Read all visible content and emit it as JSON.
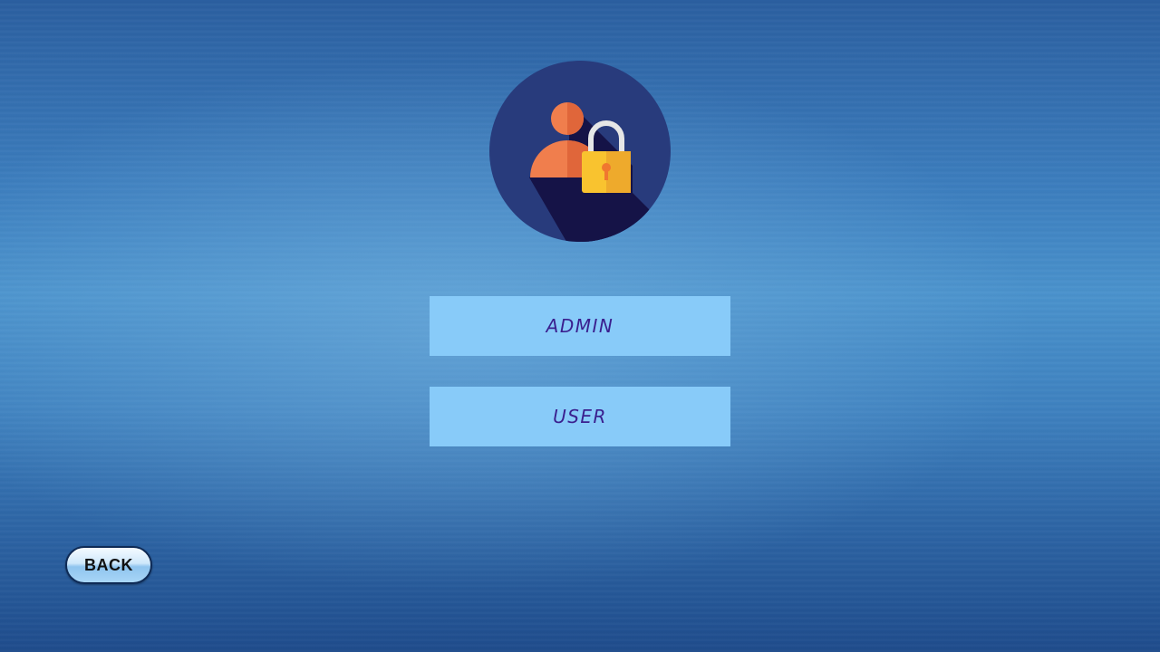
{
  "logo": {
    "icon": "user-lock-icon",
    "colors": {
      "circle": "#283b7c",
      "shadow": "#151347",
      "person": "#f07e4d",
      "person_shade": "#e0663a",
      "lock_body": "#f9c32f",
      "lock_shade": "#eeaa2c",
      "shackle": "#e6e6e6",
      "keyhole": "#f0772f"
    }
  },
  "buttons": {
    "admin_label": "ADMIN",
    "user_label": "USER",
    "color": "#88cbf9",
    "text_color": "#3a1f8e"
  },
  "back": {
    "label": "BACK"
  }
}
